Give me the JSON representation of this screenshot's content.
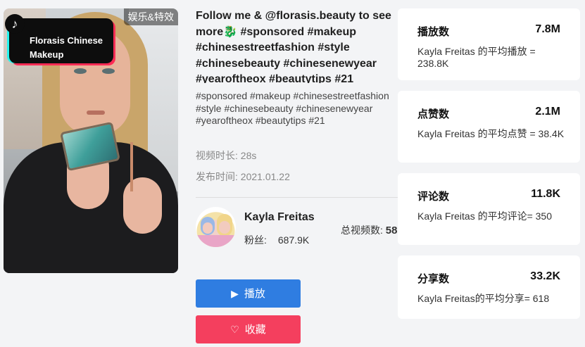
{
  "video": {
    "category_badge": "娱乐&特效",
    "overlay_line1": "Florasis Chinese",
    "overlay_line2": "Makeup",
    "title_part1": "Follow me & @florasis.beauty to see more",
    "title_emoji": "🐉",
    "title_part2": " #sponsored #makeup #chinesestreetfashion #style #chinesebeauty #chinesenewyear #yearoftheox #beautytips #21",
    "tags_text": "#sponsored  #makeup  #chinesestreetfashion  #style  #chinesebeauty  #chinesenewyear  #yearoftheox  #beautytips  #21",
    "duration_label": "视频时长:",
    "duration_value": "28s",
    "publish_label": "发布时间:",
    "publish_value": "2021.01.22"
  },
  "author": {
    "name": "Kayla Freitas",
    "fans_label": "粉丝:",
    "fans_value": "687.9K",
    "total_videos_label": "总视频数:",
    "total_videos_value": "58"
  },
  "buttons": {
    "play_label": "播放",
    "favorite_label": "收藏"
  },
  "stats": [
    {
      "label": "播放数",
      "value": "7.8M",
      "desc": "Kayla Freitas 的平均播放 = 238.8K"
    },
    {
      "label": "点赞数",
      "value": "2.1M",
      "desc": "Kayla Freitas 的平均点赞 = 38.4K"
    },
    {
      "label": "评论数",
      "value": "11.8K",
      "desc": "Kayla Freitas 的平均评论= 350"
    },
    {
      "label": "分享数",
      "value": "33.2K",
      "desc": "Kayla Freitas的平均分享= 618"
    }
  ],
  "colors": {
    "play_button": "#2f7de1",
    "favorite_button": "#f43f5e",
    "background": "#f3f4f6"
  }
}
